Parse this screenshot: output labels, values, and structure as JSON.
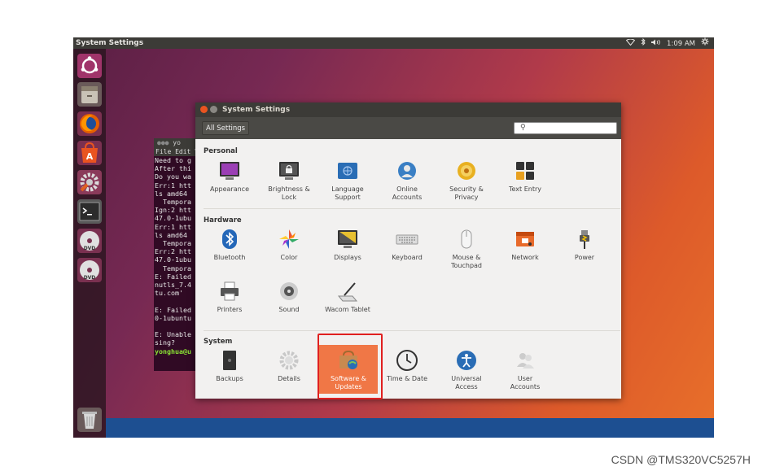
{
  "topbar": {
    "title": "System Settings",
    "time": "1:09 AM"
  },
  "terminal": {
    "title": "yo",
    "menu": "File  Edit  V",
    "lines": [
      "Need to g",
      "After thi",
      "Do you wa",
      "Err:1 htt",
      "ls amd64 ",
      "  Tempora",
      "Ign:2 htt",
      "47.0-1ubu",
      "Err:1 htt",
      "ls amd64 ",
      "  Tempora",
      "Err:2 htt",
      "47.0-1ubu",
      "  Tempora",
      "E: Failed",
      "nutls_7.4",
      "tu.com'",
      "",
      "E: Failed",
      "0-1ubuntu",
      "",
      "E: Unable",
      "sing?"
    ],
    "prompt": "yonghua@u"
  },
  "window": {
    "title": "System Settings",
    "all_settings": "All Settings",
    "search_placeholder": ""
  },
  "sections": {
    "personal": "Personal",
    "hardware": "Hardware",
    "system": "System"
  },
  "personal_items": [
    "Appearance",
    "Brightness &\nLock",
    "Language\nSupport",
    "Online\nAccounts",
    "Security &\nPrivacy",
    "Text Entry"
  ],
  "hardware_items": [
    "Bluetooth",
    "Color",
    "Displays",
    "Keyboard",
    "Mouse &\nTouchpad",
    "Network",
    "Power",
    "Printers",
    "Sound",
    "Wacom Tablet"
  ],
  "system_items": [
    "Backups",
    "Details",
    "Software &\nUpdates",
    "Time & Date",
    "Universal\nAccess",
    "User\nAccounts"
  ],
  "watermark": "CSDN @TMS320VC5257H"
}
